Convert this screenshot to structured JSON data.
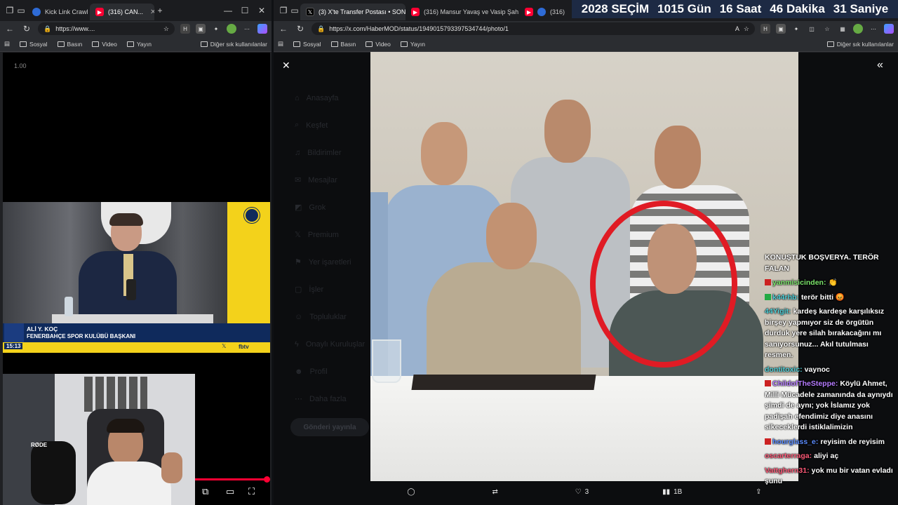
{
  "left_browser": {
    "tabs": [
      {
        "label": "Kick Link Crawl",
        "icon": "globe-icon"
      },
      {
        "label": "(316) CAN...",
        "icon": "youtube-icon"
      }
    ],
    "url": "https://www....",
    "bookmarks": [
      "Sosyal",
      "Basın",
      "Video",
      "Yayın"
    ],
    "bookmarks_other": "Diğer sık kullanılanlar",
    "zoom_text": "1.00",
    "video": {
      "speaker_name": "ALİ Y. KOÇ",
      "speaker_title": "FENERBAHÇE SPOR KULÜBÜ BAŞKANI",
      "clock": "15:13",
      "channel": "fbtv",
      "banner_text": "HÇE SPOR"
    },
    "player_progress_percent": 99
  },
  "right_browser": {
    "tabs": [
      {
        "label": "(3) X'te Transfer Postası • SON...",
        "icon": "x-icon"
      },
      {
        "label": "(316) Mansur Yavaş ve Vasip Şah...",
        "icon": "youtube-icon"
      },
      {
        "label": "(316)",
        "icon": "youtube-icon"
      }
    ],
    "url": "https://x.com/HaberMOD/status/1949015793397534744/photo/1",
    "bookmarks": [
      "Sosyal",
      "Basın",
      "Video",
      "Yayın"
    ],
    "bookmarks_other": "Diğer sık kullanılanlar",
    "x_menu": [
      "Anasayfa",
      "Keşfet",
      "Bildirimler",
      "Mesajlar",
      "Grok",
      "Premium",
      "Yer işaretleri",
      "İşler",
      "Topluluklar",
      "Onaylı Kuruluşlar",
      "Profil",
      "Daha fazla"
    ],
    "post_button": "Gönderi yayınla",
    "photo_actions": {
      "comments": "",
      "reposts": "",
      "likes": "3",
      "views": "1B"
    }
  },
  "countdown": {
    "year": "2028",
    "label": "SEÇİM",
    "days": "1015",
    "days_label": "Gün",
    "hours": "16",
    "hours_label": "Saat",
    "minutes": "46",
    "minutes_label": "Dakika",
    "seconds": "31",
    "seconds_label": "Saniye"
  },
  "chat": [
    {
      "user": "",
      "user_color": "#ffffff",
      "badge": "",
      "text": "KONUŞTUK BOŞVERYA. TERÖR FALAN"
    },
    {
      "user": "yanmisicinden:",
      "user_color": "#7be56b",
      "badge": "#cc2222",
      "text": "👏"
    },
    {
      "user": "k44rhb:",
      "user_color": "#4fd1d9",
      "badge": "#22aa44",
      "text": "terör bitti 😡"
    },
    {
      "user": "44Yigit:",
      "user_color": "#4fd1d9",
      "badge": "",
      "text": "kardeş kardeşe karşılıksız birşey yapmıyor siz de örgütün durduk yere silah bırakacağını mı sanıyorsunuz... Akıl tutulması resmen."
    },
    {
      "user": "dontitoxic:",
      "user_color": "#4fd1d9",
      "badge": "",
      "text": "vaynoc"
    },
    {
      "user": "ChildofTheSteppe:",
      "user_color": "#b57bff",
      "badge": "#cc2222",
      "text": "Köylü Ahmet, Milli Mücadele zamanında da aynıydı şimdi de aynı; yok İslamız yok padişah efendimiz diye anasını sikeceklerdi istiklalimizin"
    },
    {
      "user": "hourglass_e:",
      "user_color": "#5b8cff",
      "badge": "#cc2222",
      "text": "reyisim de reyisim"
    },
    {
      "user": "oscarterraga:",
      "user_color": "#ff5a78",
      "badge": "",
      "text": "aliyi aç"
    },
    {
      "user": "Vattghern31:",
      "user_color": "#ff5a78",
      "badge": "",
      "text": "yok mu bir vatan evladı şunu"
    }
  ],
  "colors": {
    "accent_red": "#e01b24",
    "fb_yellow": "#f3d21b",
    "fb_navy": "#0f2a5c",
    "timer_bg": "#1d2a44"
  }
}
